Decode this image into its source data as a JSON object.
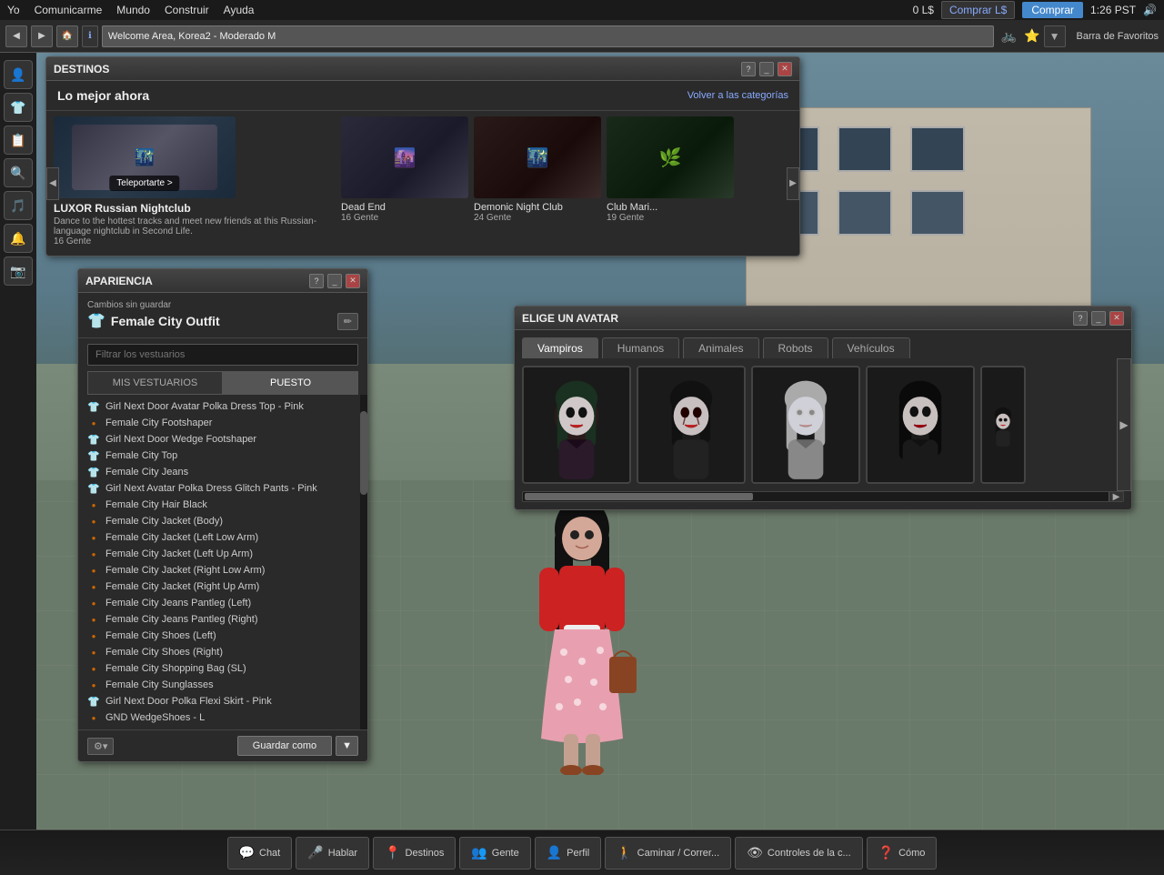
{
  "topMenu": {
    "items": [
      "Yo",
      "Comunicarme",
      "Mundo",
      "Construir",
      "Ayuda"
    ],
    "rightItems": [
      "0 L$",
      "Comprar L$",
      "Comprar",
      "1:26 PST"
    ]
  },
  "navBar": {
    "addressBarText": "Welcome Area, Korea2 - Moderado M",
    "favoritesText": "Barra de Favoritos"
  },
  "destinos": {
    "title": "DESTINOS",
    "sectionTitle": "Lo mejor ahora",
    "backLink": "Volver a las categorías",
    "places": [
      {
        "name": "LUXOR Russian Nightclub",
        "description": "Dance to the hottest tracks and meet new friends at this Russian-language nightclub in Second Life.",
        "people": "16 Gente",
        "teleportLabel": "Teleportarte >"
      },
      {
        "name": "Dead End",
        "people": "16 Gente"
      },
      {
        "name": "Demonic Night Club",
        "people": "24 Gente"
      },
      {
        "name": "Club Mari...",
        "people": "19 Gente"
      }
    ]
  },
  "apariencia": {
    "title": "APARIENCIA",
    "unsavedLabel": "Cambios sin guardar",
    "outfitName": "Female City Outfit",
    "searchPlaceholder": "Filtrar los vestuarios",
    "tabs": [
      "MIS VESTUARIOS",
      "PUESTO"
    ],
    "activeTab": "PUESTO",
    "items": [
      {
        "icon": "shirt",
        "name": "Girl Next Door Avatar Polka Dress Top - Pink"
      },
      {
        "icon": "orange",
        "name": "Female City Footshaper"
      },
      {
        "icon": "shirt",
        "name": "Girl Next Door Wedge Footshaper"
      },
      {
        "icon": "shirt",
        "name": "Female City Top"
      },
      {
        "icon": "shirt",
        "name": "Female City Jeans"
      },
      {
        "icon": "shirt",
        "name": "Girl Next Avatar Polka Dress Glitch Pants - Pink"
      },
      {
        "icon": "orange",
        "name": "Female City Hair Black"
      },
      {
        "icon": "orange",
        "name": "Female City Jacket (Body)"
      },
      {
        "icon": "orange",
        "name": "Female City Jacket (Left Low Arm)"
      },
      {
        "icon": "orange",
        "name": "Female City Jacket (Left Up Arm)"
      },
      {
        "icon": "orange",
        "name": "Female City Jacket (Right Low Arm)"
      },
      {
        "icon": "orange",
        "name": "Female City Jacket (Right Up Arm)"
      },
      {
        "icon": "orange",
        "name": "Female City Jeans Pantleg (Left)"
      },
      {
        "icon": "orange",
        "name": "Female City Jeans Pantleg (Right)"
      },
      {
        "icon": "orange",
        "name": "Female City Shoes (Left)"
      },
      {
        "icon": "orange",
        "name": "Female City Shoes (Right)"
      },
      {
        "icon": "orange",
        "name": "Female City Shopping Bag (SL)"
      },
      {
        "icon": "orange",
        "name": "Female City Sunglasses"
      },
      {
        "icon": "shirt",
        "name": "Girl Next Door Polka Flexi Skirt - Pink"
      },
      {
        "icon": "orange",
        "name": "GND WedgeShoes - L"
      }
    ],
    "saveLabel": "Guardar como"
  },
  "avatarWindow": {
    "title": "ELIGE UN AVATAR",
    "tabs": [
      "Vampiros",
      "Humanos",
      "Animales",
      "Robots",
      "Vehículos"
    ],
    "activeTab": "Vampiros"
  },
  "taskbar": {
    "buttons": [
      {
        "icon": "💬",
        "label": "Chat"
      },
      {
        "icon": "🎤",
        "label": "Hablar"
      },
      {
        "icon": "📍",
        "label": "Destinos"
      },
      {
        "icon": "👥",
        "label": "Gente"
      },
      {
        "icon": "👤",
        "label": "Perfil"
      },
      {
        "icon": "🚶",
        "label": "Caminar / Correr..."
      },
      {
        "icon": "👁",
        "label": "Controles de la c..."
      },
      {
        "icon": "❓",
        "label": "Cómo"
      }
    ]
  },
  "sidebar": {
    "icons": [
      "👤",
      "👕",
      "📋",
      "🔍",
      "🎵",
      "🔔",
      "📷"
    ]
  }
}
